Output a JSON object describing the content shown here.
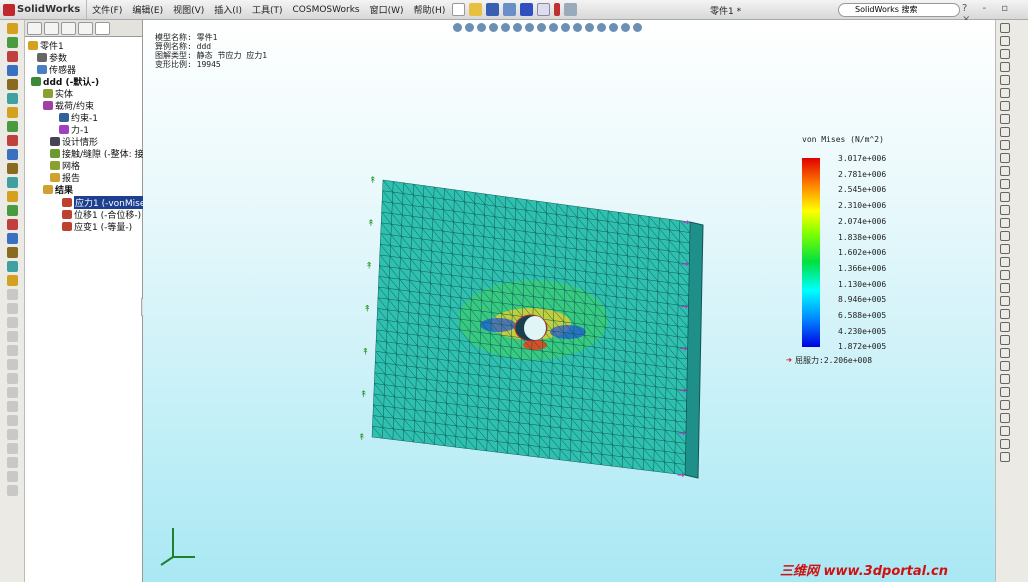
{
  "app": {
    "name": "SolidWorks",
    "doc_title": "零件1 *",
    "search_placeholder": "SolidWorks 搜索",
    "window_controls": "? - ▫ ×"
  },
  "menu": [
    "文件(F)",
    "编辑(E)",
    "视图(V)",
    "插入(I)",
    "工具(T)",
    "COSMOSWorks",
    "窗口(W)",
    "帮助(H)"
  ],
  "tree": {
    "root": "零件1",
    "params": "参数",
    "sensors": "传感器",
    "study": "ddd (-默认-)",
    "solid": "实体",
    "loads": "载荷/约束",
    "fixture": "约束-1",
    "force": "力-1",
    "design": "设计情形",
    "contact": "接触/缝隙 (-整体: 接",
    "mesh": "网格",
    "report": "报告",
    "results": "结果",
    "stress": "应力1 (-vonMise",
    "displacement": "位移1 (-合位移-)",
    "strain": "应变1 (-等量-)"
  },
  "info": [
    "模型名称: 零件1",
    "算例名称: ddd",
    "图解类型: 静态 节应力 应力1",
    "变形比例: 19945"
  ],
  "legend": {
    "title": "von Mises (N/m^2)",
    "ticks": [
      "3.017e+006",
      "2.781e+006",
      "2.545e+006",
      "2.310e+006",
      "2.074e+006",
      "1.838e+006",
      "1.602e+006",
      "1.366e+006",
      "1.130e+006",
      "8.946e+005",
      "6.588e+005",
      "4.230e+005",
      "1.872e+005"
    ],
    "yield": "屈服力:2.206e+008",
    "colors": [
      "#e00000",
      "#ffff00",
      "#00e040",
      "#00ffff",
      "#0000e0"
    ]
  },
  "watermark": "三维网 www.3dportal.cn"
}
